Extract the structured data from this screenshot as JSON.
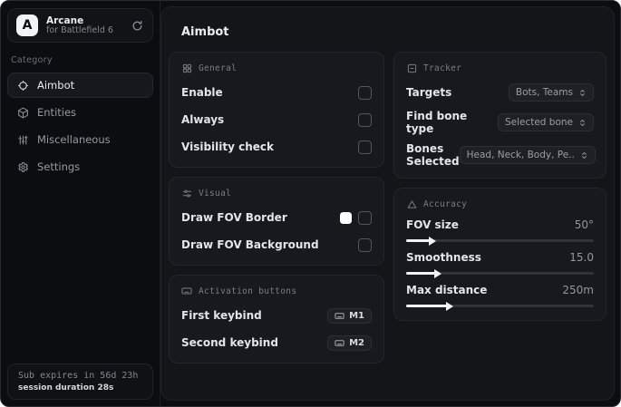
{
  "app": {
    "name": "Arcane",
    "subtitle": "for Battlefield 6",
    "logo_letter": "A"
  },
  "sidebar": {
    "category_label": "Category",
    "items": [
      {
        "label": "Aimbot",
        "active": true
      },
      {
        "label": "Entities",
        "active": false
      },
      {
        "label": "Miscellaneous",
        "active": false
      },
      {
        "label": "Settings",
        "active": false
      }
    ],
    "sub_expiry": "Sub expires in 56d 23h",
    "session_duration": "session duration 28s"
  },
  "main": {
    "title": "Aimbot"
  },
  "cards": {
    "general": {
      "title": "General",
      "rows": [
        {
          "label": "Enable",
          "checked": false
        },
        {
          "label": "Always",
          "checked": false
        },
        {
          "label": "Visibility check",
          "checked": false
        }
      ]
    },
    "visual": {
      "title": "Visual",
      "rows": [
        {
          "label": "Draw FOV Border",
          "checked": false,
          "swatch_color": "#ffffff"
        },
        {
          "label": "Draw FOV Background",
          "checked": false
        }
      ]
    },
    "activation": {
      "title": "Activation buttons",
      "rows": [
        {
          "label": "First keybind",
          "key": "M1"
        },
        {
          "label": "Second keybind",
          "key": "M2"
        }
      ]
    },
    "tracker": {
      "title": "Tracker",
      "rows": [
        {
          "label": "Targets",
          "value": "Bots, Teams"
        },
        {
          "label": "Find bone type",
          "value": "Selected bone"
        },
        {
          "label": "Bones Selected",
          "value": "Head, Neck, Body, Pe.."
        }
      ]
    },
    "accuracy": {
      "title": "Accuracy",
      "sliders": [
        {
          "label": "FOV size",
          "value": "50°",
          "fill_percent": 13
        },
        {
          "label": "Smoothness",
          "value": "15.0",
          "fill_percent": 16
        },
        {
          "label": "Max distance",
          "value": "250m",
          "fill_percent": 22
        }
      ]
    }
  },
  "icons": {
    "reload-icon": "circular-arrow",
    "aimbot-icon": "crosshair",
    "entities-icon": "cube",
    "miscellaneous-icon": "sliders-vertical",
    "settings-icon": "gear",
    "general-icon": "grid",
    "visual-icon": "sliders-horizontal",
    "activation-icon": "keyboard",
    "tracker-icon": "square-minus",
    "accuracy-icon": "triangle",
    "dropdown-icon": "unfold-chevrons",
    "keybind-icon": "keyboard"
  },
  "colors": {
    "window_bg": "#0c0d10",
    "panel_bg": "#141519",
    "card_bg": "#18191e",
    "card_border": "#242529",
    "accent_fill": "#f2f3f5",
    "text_primary": "#e4e5e8",
    "text_muted": "#95979c",
    "swatch": "#ffffff"
  }
}
